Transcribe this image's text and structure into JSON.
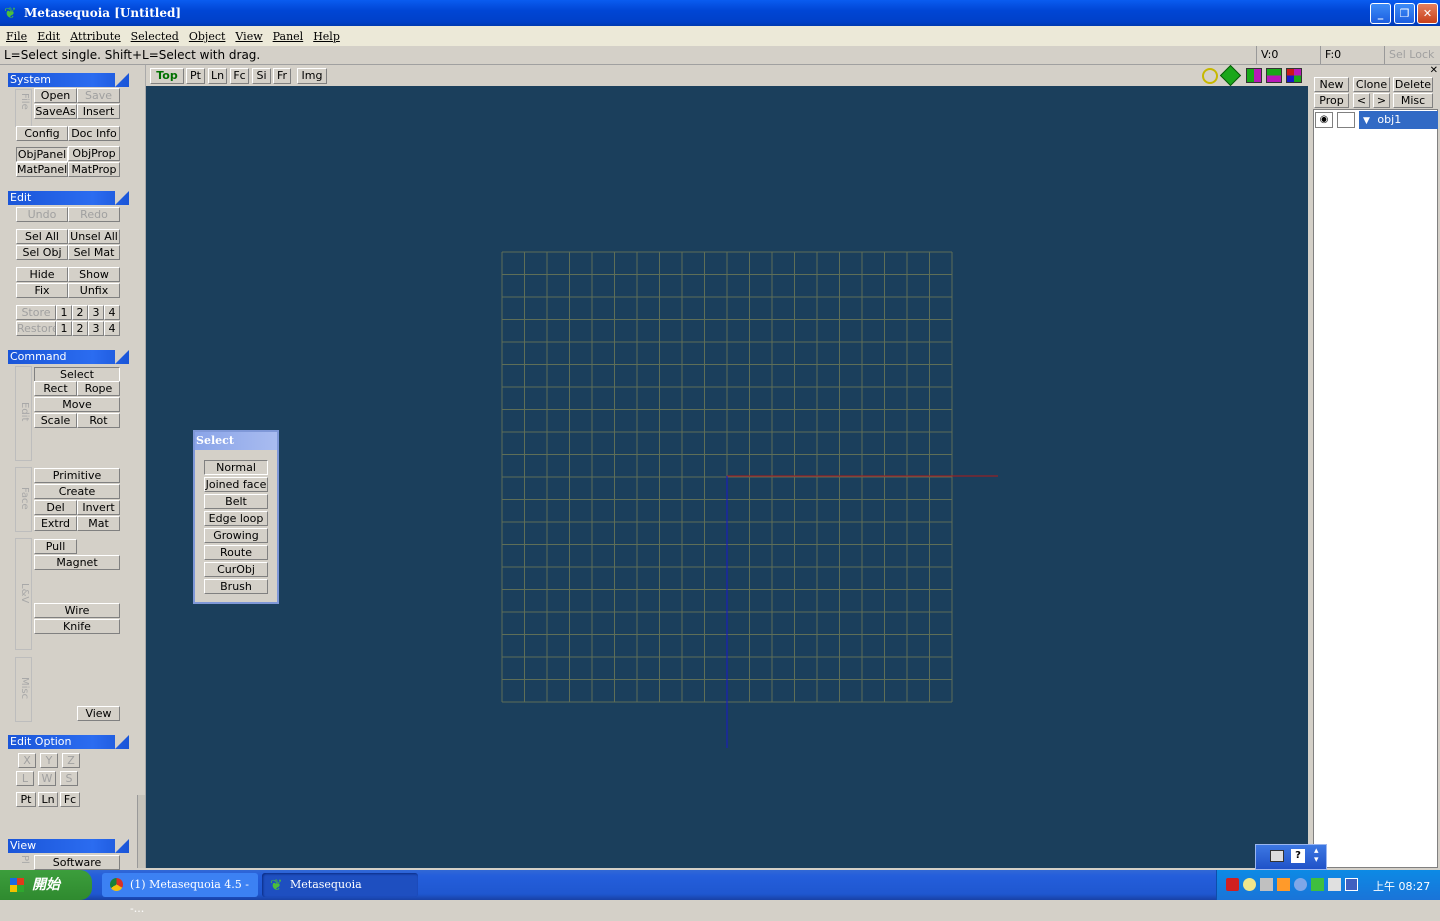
{
  "window": {
    "title": "Metasequoia [Untitled]"
  },
  "menu": [
    "File",
    "Edit",
    "Attribute",
    "Selected",
    "Object",
    "View",
    "Panel",
    "Help"
  ],
  "status": {
    "hint": "L=Select single.  Shift+L=Select with drag.",
    "vertices": "V:0",
    "faces": "F:0",
    "sel_lock": "Sel Lock"
  },
  "system": {
    "header": "System",
    "file_label": "File",
    "open": "Open",
    "save": "Save",
    "saveas": "SaveAs",
    "insert": "Insert",
    "config": "Config",
    "docinfo": "Doc Info",
    "objpanel": "ObjPanel",
    "objprop": "ObjProp",
    "matpanel": "MatPanel",
    "matprop": "MatProp"
  },
  "edit": {
    "header": "Edit",
    "undo": "Undo",
    "redo": "Redo",
    "selall": "Sel All",
    "unselall": "Unsel All",
    "selobj": "Sel Obj",
    "selmat": "Sel Mat",
    "hide": "Hide",
    "show": "Show",
    "fix": "Fix",
    "unfix": "Unfix",
    "store": "Store",
    "restore": "Restore",
    "slots": [
      "1",
      "2",
      "3",
      "4"
    ]
  },
  "command": {
    "header": "Command",
    "edit_label": "Edit",
    "face_label": "Face",
    "lv_label": "L&V",
    "misc_label": "Misc",
    "select": "Select",
    "rect": "Rect",
    "rope": "Rope",
    "move": "Move",
    "scale": "Scale",
    "rot": "Rot",
    "primitive": "Primitive",
    "create": "Create",
    "del": "Del",
    "invert": "Invert",
    "extrd": "Extrd",
    "mat": "Mat",
    "pull": "Pull",
    "magnet": "Magnet",
    "wire": "Wire",
    "knife": "Knife",
    "view": "View"
  },
  "editoption": {
    "header": "Edit Option",
    "x": "X",
    "y": "Y",
    "z": "Z",
    "l": "L",
    "w": "W",
    "s": "S",
    "pt": "Pt",
    "ln": "Ln",
    "fc": "Fc"
  },
  "viewsec": {
    "header": "View",
    "software": "Software",
    "p_label": "Pl"
  },
  "viewtabs": {
    "top": "Top",
    "pt": "Pt",
    "ln": "Ln",
    "fc": "Fc",
    "si": "Si",
    "fr": "Fr",
    "img": "Img"
  },
  "select_window": {
    "title": "Select",
    "items": [
      "Normal",
      "Joined face",
      "Belt",
      "Edge loop",
      "Growing",
      "Route",
      "CurObj",
      "Brush"
    ]
  },
  "objpanel": {
    "new": "New",
    "clone": "Clone",
    "delete": "Delete",
    "prop": "Prop",
    "prev": "<",
    "next": ">",
    "misc": "Misc",
    "object": "obj1"
  },
  "taskbar": {
    "start": "開始",
    "task1": "(1) Metasequoia 4.5 - -...",
    "task2": "Metasequoia",
    "clock": "上午 08:27"
  },
  "colors": {
    "viewport": "#1b3f5c",
    "grid": "#5e6e57",
    "x_axis": "#b01818",
    "z_axis": "#1818c8",
    "accent": "#1a55d8"
  }
}
